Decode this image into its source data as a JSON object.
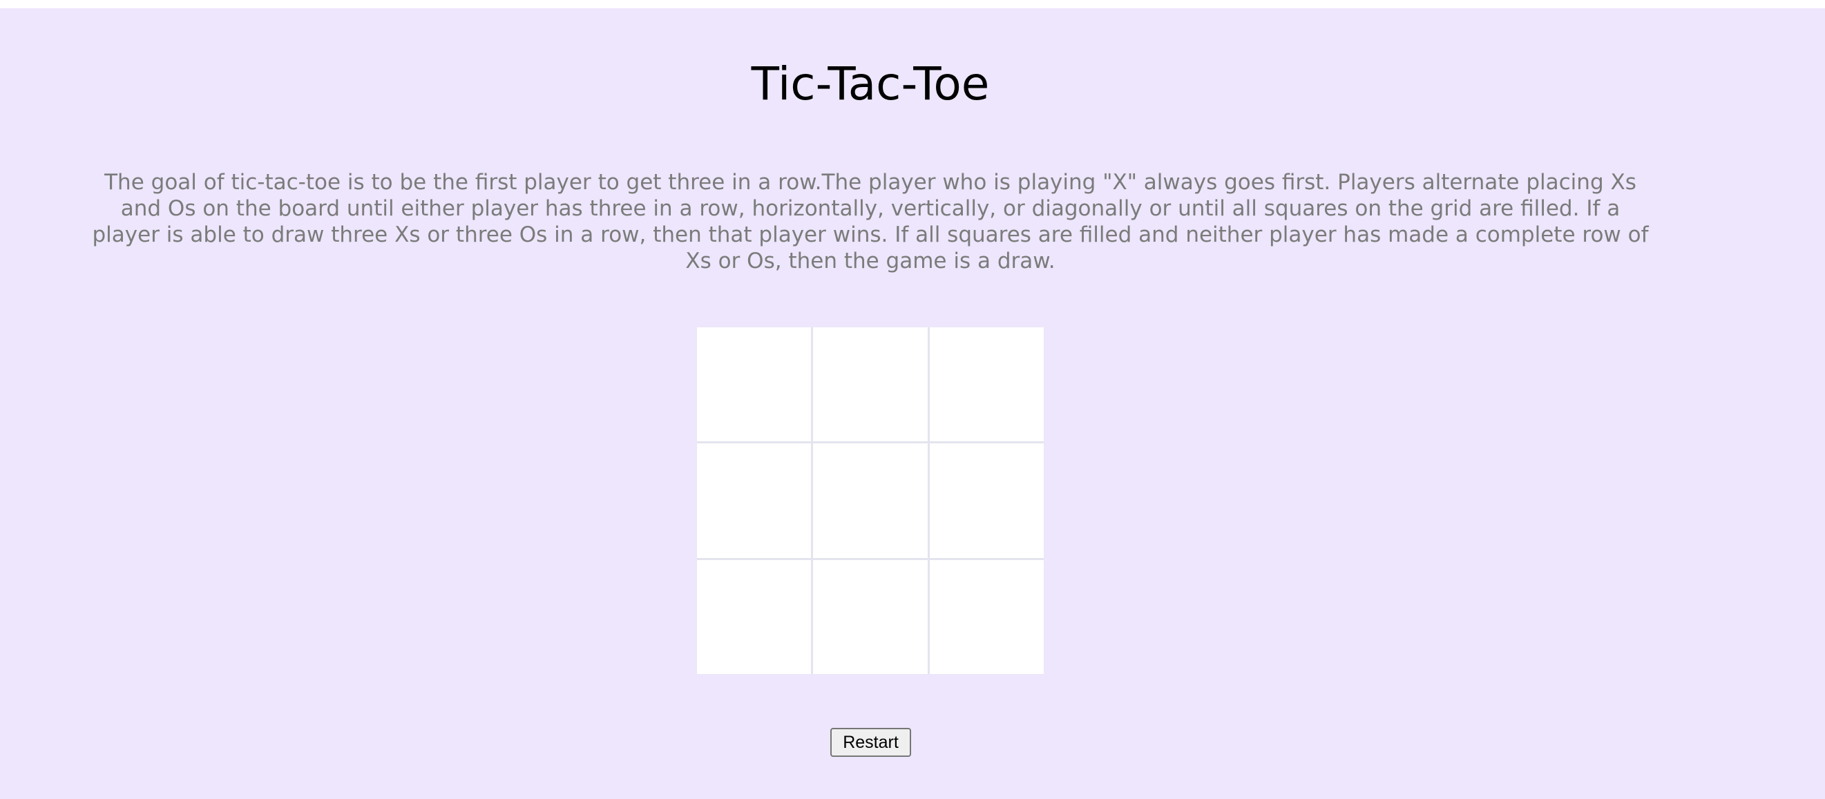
{
  "header": {
    "title": "Tic-Tac-Toe"
  },
  "rules": {
    "text": "The goal of tic-tac-toe is to be the first player to get three in a row.The player who is playing \"X\" always goes first. Players alternate placing Xs and Os on the board until either player has three in a row, horizontally, vertically, or diagonally or until all squares on the grid are filled. If a player is able to draw three Xs or three Os in a row, then that player wins. If all squares are filled and neither player has made a complete row of Xs or Os, then the game is a draw."
  },
  "board": {
    "cells": [
      "",
      "",
      "",
      "",
      "",
      "",
      "",
      "",
      ""
    ]
  },
  "controls": {
    "restart_label": "Restart"
  },
  "colors": {
    "background": "#ede6fc",
    "cell": "#ffffff",
    "grid_line": "#e4e4ef",
    "description_text": "#7b7b7b"
  }
}
